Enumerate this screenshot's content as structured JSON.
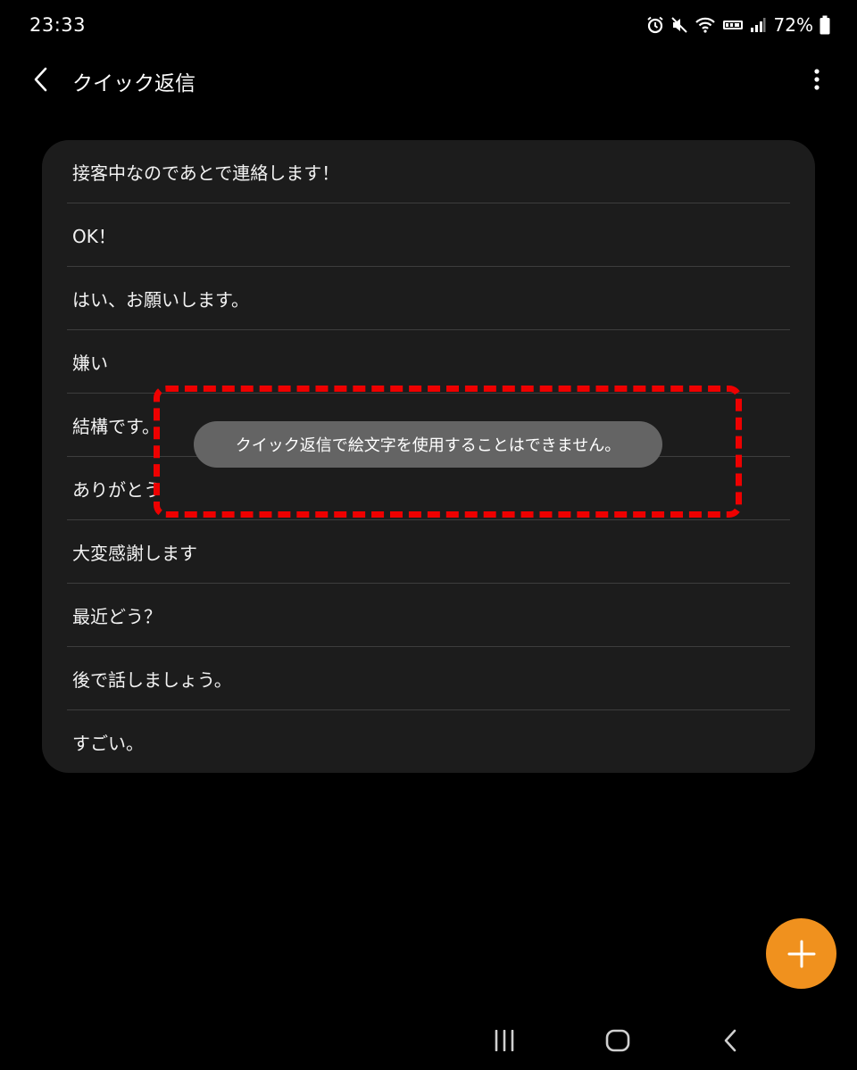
{
  "status_bar": {
    "time": "23:33",
    "battery_percent": "72%",
    "icons": [
      "alarm-icon",
      "mute-icon",
      "wifi-icon",
      "volte-icon",
      "signal-icon",
      "battery-icon"
    ]
  },
  "app_bar": {
    "title": "クイック返信"
  },
  "replies": [
    {
      "label": "接客中なのであとで連絡します！"
    },
    {
      "label": "OK！"
    },
    {
      "label": "はい、お願いします。"
    },
    {
      "label": "嫌い"
    },
    {
      "label": "結構です。"
    },
    {
      "label": "ありがとう"
    },
    {
      "label": "大変感謝します"
    },
    {
      "label": "最近どう？"
    },
    {
      "label": "後で話しましょう。"
    },
    {
      "label": "すごい。"
    }
  ],
  "toast": {
    "message": "クイック返信で絵文字を使用することはできません。"
  },
  "colors": {
    "background": "#000000",
    "card": "#1c1c1c",
    "toast": "#646464",
    "fab": "#f0911e",
    "highlight": "#ee0000"
  }
}
